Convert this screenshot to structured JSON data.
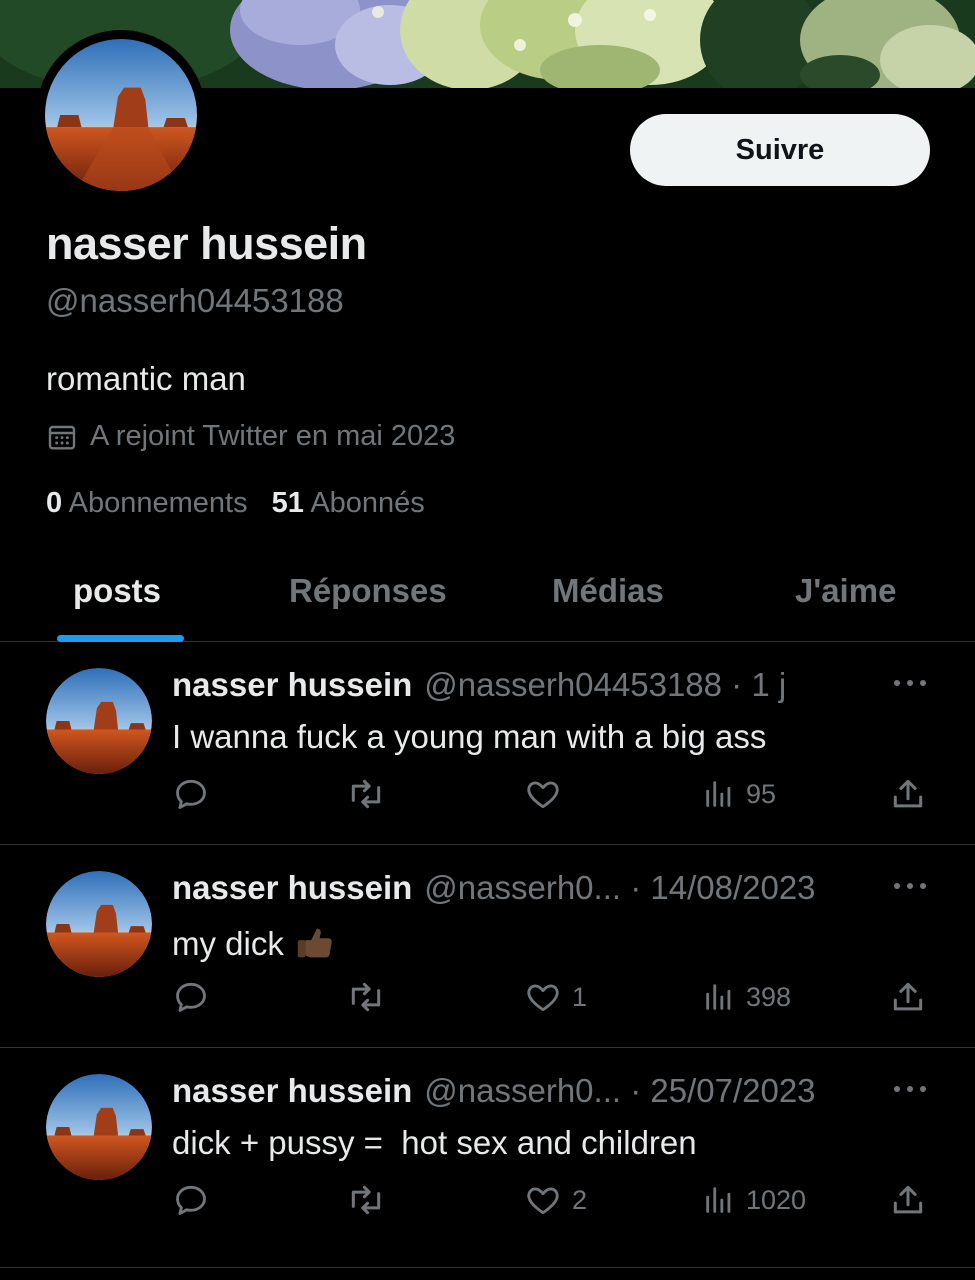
{
  "profile": {
    "display_name": "nasser hussein",
    "handle": "@nasserh04453188",
    "bio": "romantic man",
    "joined": "A rejoint Twitter en mai 2023",
    "following_count": "0",
    "following_label": "Abonnements",
    "followers_count": "51",
    "followers_label": "Abonnés",
    "follow_label": "Suivre",
    "icons": {
      "calendar": "calendar-icon"
    }
  },
  "tabs": [
    {
      "label": "posts",
      "active": true
    },
    {
      "label": "Réponses",
      "active": false
    },
    {
      "label": "Médias",
      "active": false
    },
    {
      "label": "J'aime",
      "active": false
    }
  ],
  "posts": [
    {
      "name": "nasser hussein",
      "meta": "@nasserh04453188 · 1 j",
      "text": "I wanna fuck a young man with a big ass",
      "emoji": "",
      "likes": "",
      "views": "95"
    },
    {
      "name": "nasser hussein",
      "meta": "@nasserh0... · 14/08/2023",
      "text": "my dick",
      "emoji": "thumbs-up",
      "likes": "1",
      "views": "398"
    },
    {
      "name": "nasser hussein",
      "meta": "@nasserh0... · 25/07/2023",
      "text": "dick + pussy =  hot sex and children",
      "emoji": "",
      "likes": "2",
      "views": "1020"
    }
  ],
  "colors": {
    "background": "#000000",
    "text_primary": "#e7e9ea",
    "text_secondary": "#71767b",
    "accent": "#1d9bf0",
    "follow_button_bg": "#eff3f4",
    "divider": "#2f3336"
  }
}
